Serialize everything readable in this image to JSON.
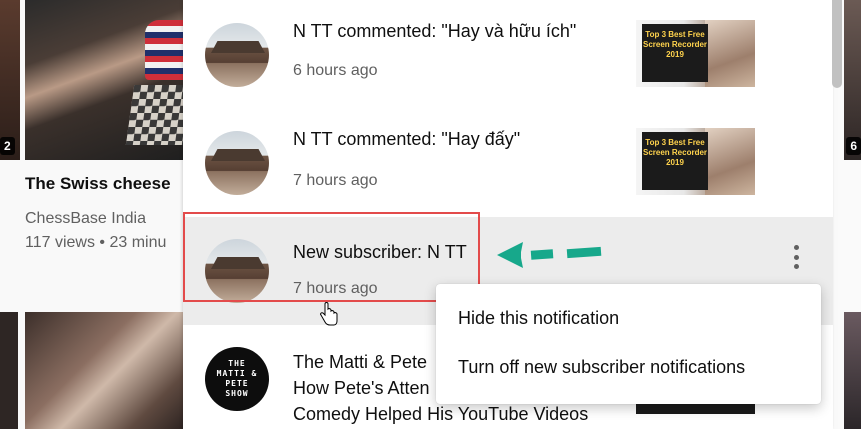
{
  "background": {
    "left_duration": "2",
    "video_duration": "",
    "right_duration": "6",
    "video_title": "The Swiss cheese",
    "channel": "ChessBase India",
    "stats": "117 views • 23 minu"
  },
  "notifications": [
    {
      "text": "N TT commented: \"Hay và hữu ích\"",
      "time": "6 hours ago",
      "thumb_text": "Top 3 Best Free Screen Recorder 2019"
    },
    {
      "text": "N TT commented: \"Hay đấy\"",
      "time": "7 hours ago",
      "thumb_text": "Top 3 Best Free Screen Recorder 2019"
    },
    {
      "text": "New subscriber: N TT",
      "time": "7 hours ago"
    },
    {
      "text": "The Matti & Pete How Pete's Atten Comedy Helped His YouTube Videos",
      "line1": "The Matti & Pete",
      "line2": "How Pete's Atten",
      "line3": "Comedy Helped His YouTube Videos",
      "avatar_text": "THE MATTI & PETE SHOW"
    }
  ],
  "menu": {
    "items": [
      "Hide this notification",
      "Turn off new subscriber notifications"
    ]
  },
  "colors": {
    "highlight": "#e34b4b",
    "arrow": "#17a88b",
    "selected_bg": "#ececec"
  }
}
